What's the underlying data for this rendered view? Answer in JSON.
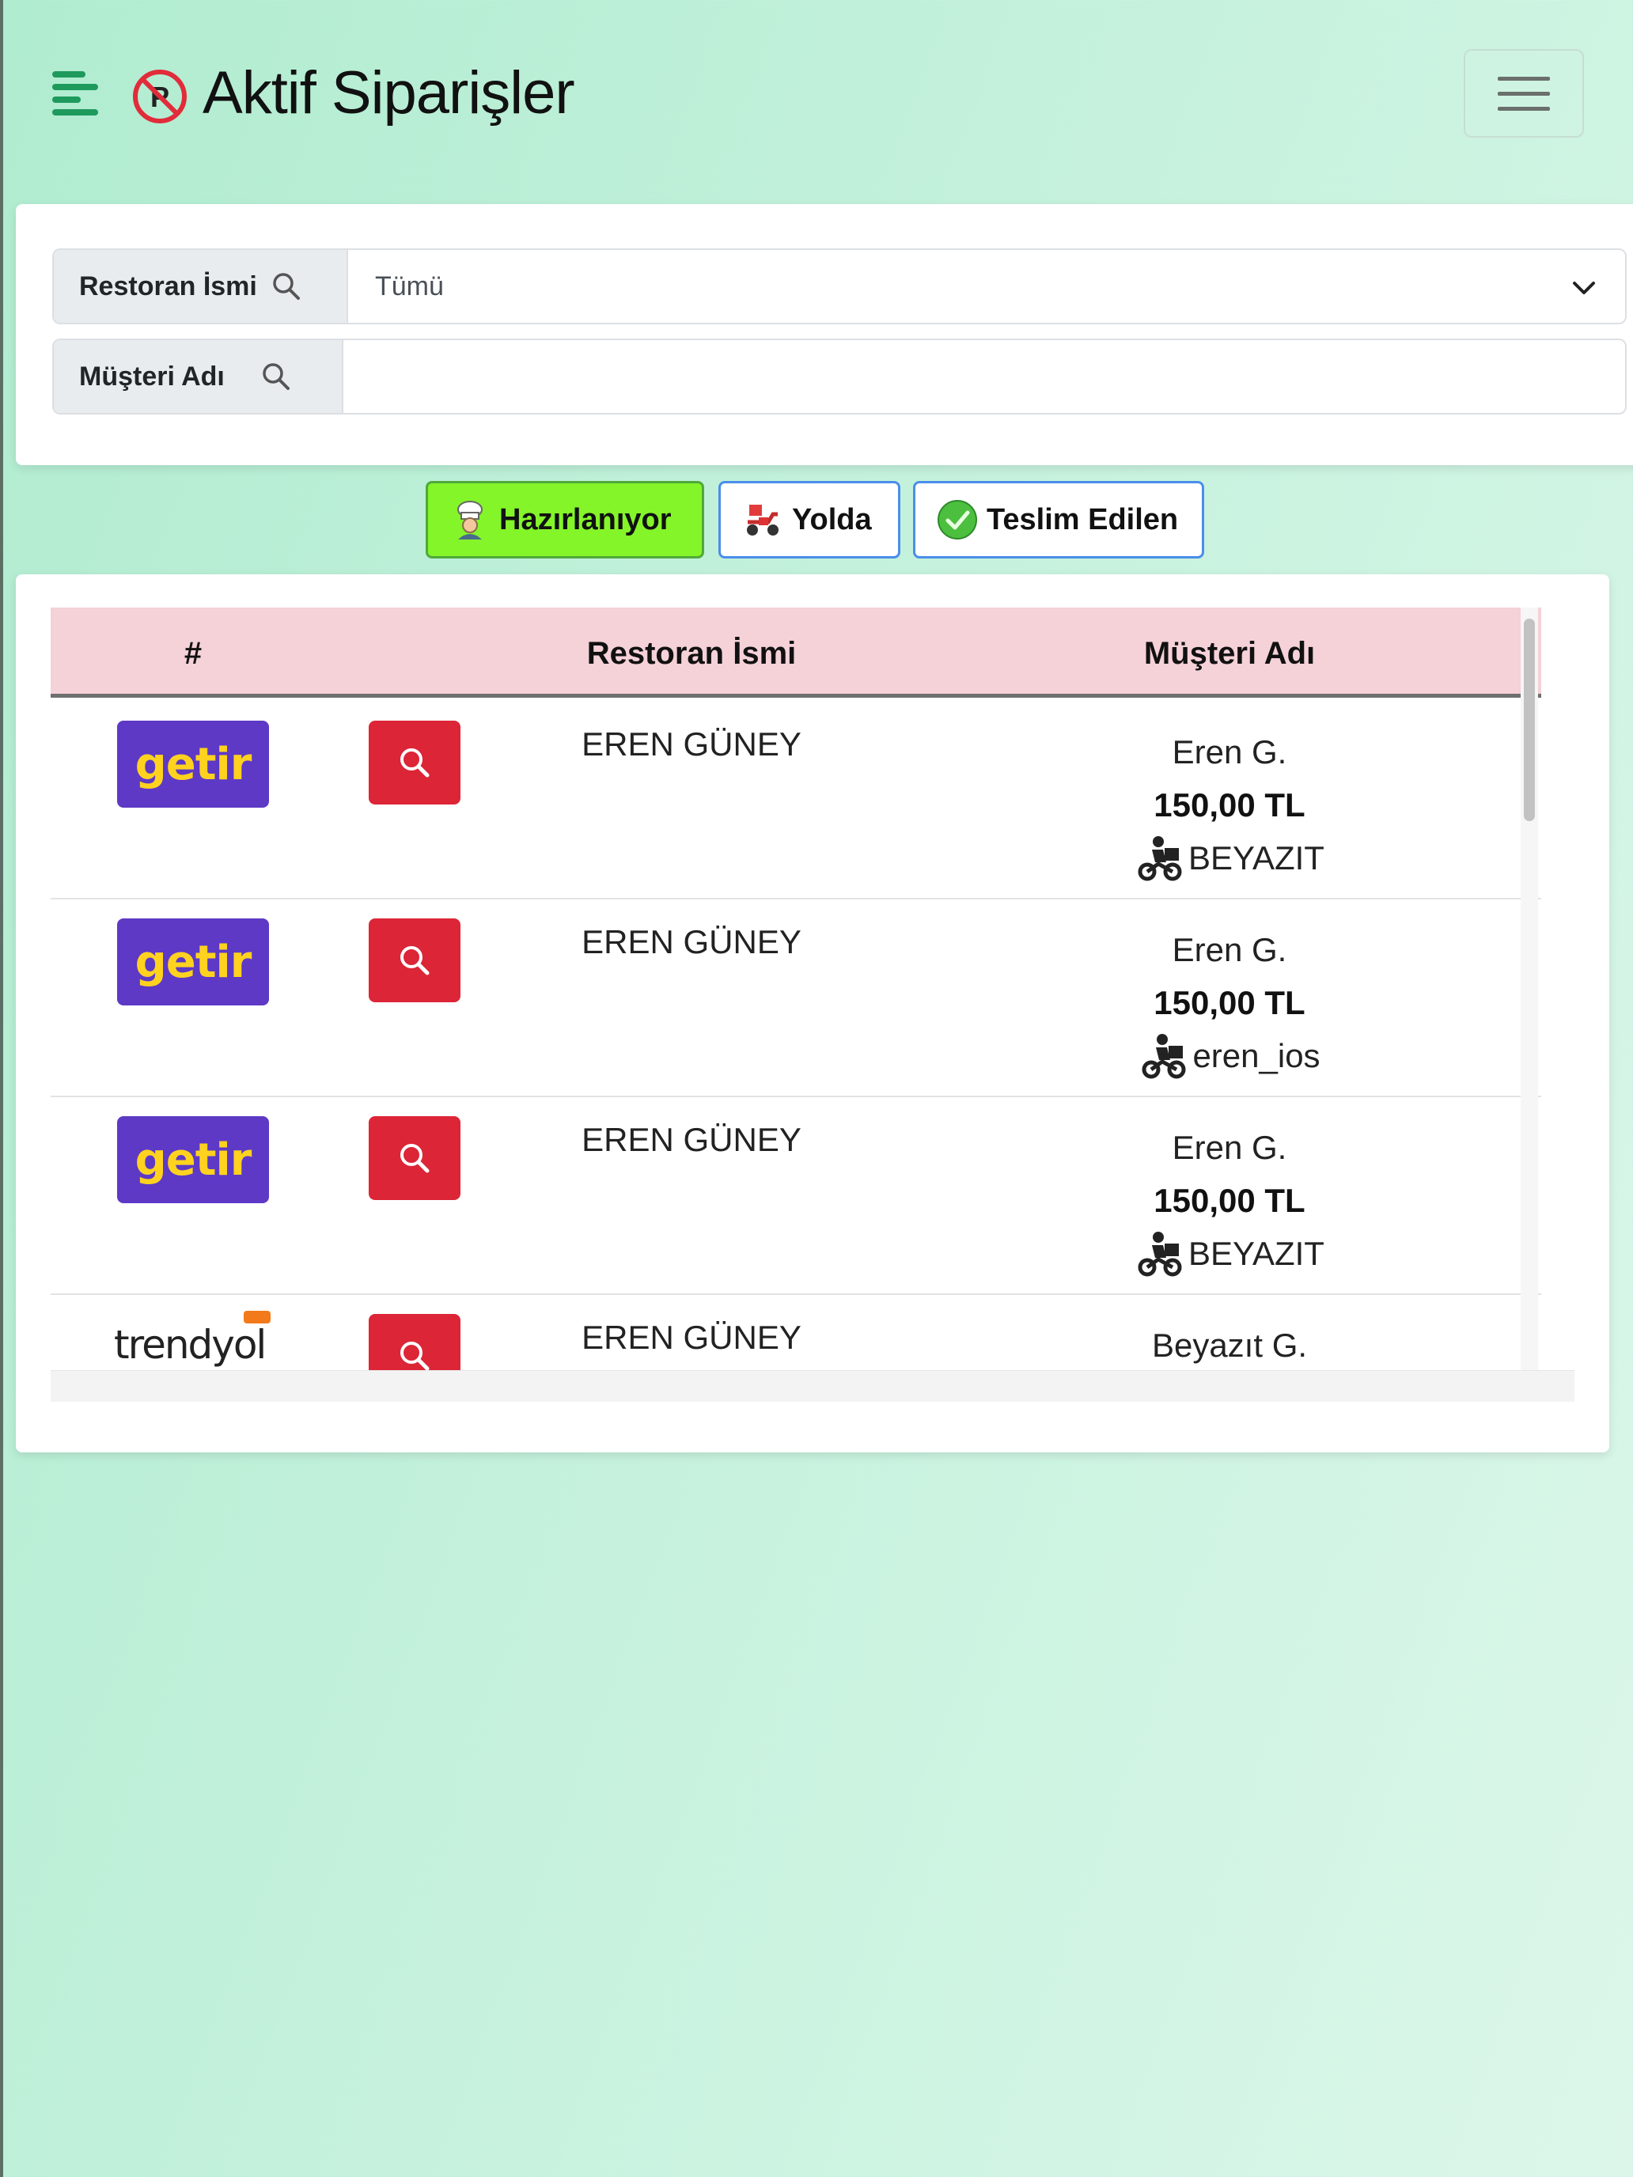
{
  "header": {
    "title": "Aktif Siparişler",
    "menu_icon": "menu-left-icon",
    "brand_icon": "no-parking-icon",
    "nav_toggle_icon": "hamburger-icon"
  },
  "filters": {
    "restaurant_label": "Restoran İsmi",
    "restaurant_value": "Tümü",
    "customer_label": "Müşteri Adı",
    "customer_value": ""
  },
  "status_buttons": [
    {
      "label": "Hazırlanıyor",
      "icon": "chef-icon",
      "active": true
    },
    {
      "label": "Yolda",
      "icon": "scooter-icon",
      "active": false
    },
    {
      "label": "Teslim Edilen",
      "icon": "check-circle-icon",
      "active": false
    }
  ],
  "table": {
    "headers": [
      "#",
      "",
      "Restoran İsmi",
      "Müşteri Adı"
    ],
    "rows": [
      {
        "platform": "getir",
        "restaurant": "EREN GÜNEY",
        "customer": "Eren G.",
        "price": "150,00 TL",
        "courier": "BEYAZIT"
      },
      {
        "platform": "getir",
        "restaurant": "EREN GÜNEY",
        "customer": "Eren G.",
        "price": "150,00 TL",
        "courier": "eren_ios"
      },
      {
        "platform": "getir",
        "restaurant": "EREN GÜNEY",
        "customer": "Eren G.",
        "price": "150,00 TL",
        "courier": "BEYAZIT"
      },
      {
        "platform": "trendyol",
        "restaurant": "EREN GÜNEY",
        "customer": "Beyazıt G.",
        "price": "",
        "courier": ""
      }
    ]
  },
  "colors": {
    "accent_green": "#1e9a5c",
    "active_button": "#84f529",
    "header_row": "#f5d1d8",
    "view_button": "#dc2537",
    "getir_purple": "#5d39c6",
    "getir_yellow": "#ffd21f"
  }
}
